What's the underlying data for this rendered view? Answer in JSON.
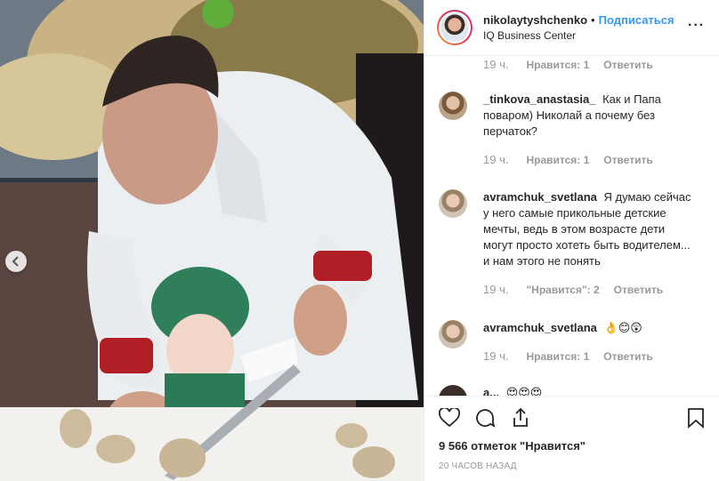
{
  "post": {
    "username": "nikolaytyshchenko",
    "separator": "•",
    "follow_label": "Подписаться",
    "location": "IQ Business Center",
    "more_label": "···"
  },
  "comments": [
    {
      "time": "19 ч.",
      "likes": "Нравится: 1",
      "reply": "Ответить"
    },
    {
      "username": "_tinkova_anastasia_",
      "text": "Как и Папа поваром) Николай а почему без перчаток?",
      "time": "19 ч.",
      "likes": "Нравится: 1",
      "reply": "Ответить"
    },
    {
      "username": "avramchuk_svetlana",
      "text": "Я думаю сейчас у него самые прикольные детские мечты, ведь в этом возрасте дети могут просто хотеть быть водителем... и нам этого не понять",
      "time": "19 ч.",
      "likes": "\"Нравится\": 2",
      "reply": "Ответить"
    },
    {
      "username": "avramchuk_svetlana",
      "text": "👌😊😲",
      "time": "19 ч.",
      "likes": "Нравится: 1",
      "reply": "Ответить"
    },
    {
      "username": "a...",
      "text": "😍😍😍",
      "time": "",
      "likes": "",
      "reply": ""
    }
  ],
  "footer": {
    "likes_count": "9 566 отметок \"Нравится\"",
    "posted": "20 часов назад"
  },
  "colors": {
    "follow": "#3897f0",
    "meta": "#999999"
  },
  "icons": [
    "chevron-left-icon",
    "heart-icon",
    "comment-icon",
    "share-icon",
    "bookmark-icon",
    "more-icon"
  ]
}
